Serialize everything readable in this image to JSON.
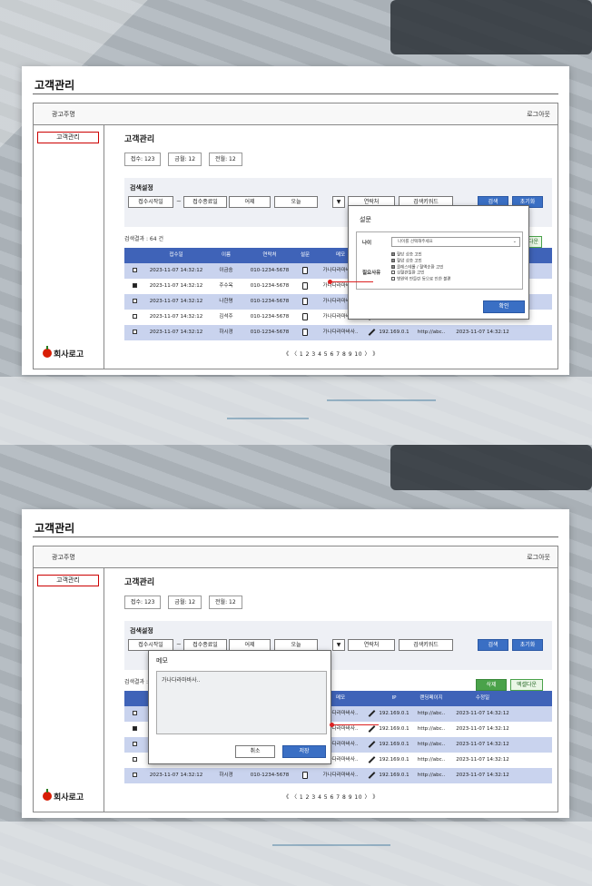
{
  "app_title": "고객관리",
  "brand": "광고주명",
  "logout": "로그아웃",
  "sidebar": {
    "item": "고객관리",
    "company": "회사로고"
  },
  "page_title": "고객관리",
  "stats": [
    "접수: 123",
    "금월: 12",
    "전월: 12"
  ],
  "search": {
    "label": "검색설정",
    "start_date": "접수시작일",
    "tilde": "~",
    "end_date": "접수종료일",
    "yesterday": "어제",
    "today": "오늘",
    "dropdown_arrow": "▼",
    "contact": "연락처",
    "keyword": "검색키워드",
    "search_btn": "검색",
    "reset_btn": "초기화"
  },
  "result_count": "검색결과 : 64 건",
  "actions": {
    "delete": "삭제",
    "excel": "엑셀다운"
  },
  "columns": [
    "",
    "접수일",
    "이름",
    "연락처",
    "설문",
    "메모",
    "",
    "IP",
    "랜딩페이지",
    "수정일"
  ],
  "rows": [
    {
      "checked": false,
      "date": "2023-11-07  14:32:12",
      "name": "이금숭",
      "phone": "010-1234-5678",
      "memo": "가나다라마바사..",
      "ip": "192.169.0.1",
      "landing": "http://abc..",
      "modified": "2023-11-07  14:32:12"
    },
    {
      "checked": true,
      "date": "2023-11-07  14:32:12",
      "name": "주수옥",
      "phone": "010-1234-5678",
      "memo": "가나다라마바사..",
      "ip": "192.169.0.1",
      "landing": "http://abc..",
      "modified": "2023-11-07  14:32:12"
    },
    {
      "checked": false,
      "date": "2023-11-07  14:32:12",
      "name": "나한명",
      "phone": "010-1234-5678",
      "memo": "가나다라마바사..",
      "ip": "192.169.0.1",
      "landing": "http://abc..",
      "modified": "2023-11-07  14:32:12"
    },
    {
      "checked": false,
      "date": "2023-11-07  14:32:12",
      "name": "김석주",
      "phone": "010-1234-5678",
      "memo": "가나다라마바사..",
      "ip": "192.169.0.1",
      "landing": "http://abc..",
      "modified": "2023-11-07  14:32:12"
    },
    {
      "checked": false,
      "date": "2023-11-07  14:32:12",
      "name": "하시경",
      "phone": "010-1234-5678",
      "memo": "가나다라마바사..",
      "ip": "192.169.0.1",
      "landing": "http://abc..",
      "modified": "2023-11-07  14:32:12"
    }
  ],
  "pager": "《 〈 1 2 3 4 5 6 7 8 9 10 〉 》",
  "survey_modal": {
    "title": "설문",
    "age_label": "나이",
    "age_value": "나이를 선택해주세요",
    "concern_label": "필요사유",
    "options": [
      {
        "label": "혈당 상승 고민",
        "checked": true
      },
      {
        "label": "혈압 상승 고민",
        "checked": true
      },
      {
        "label": "콜레스테롤 / 혈액순환 고민",
        "checked": true
      },
      {
        "label": "심혈관질환 고민",
        "checked": false
      },
      {
        "label": "병원약 만들린 등으로 인한 불편",
        "checked": false
      }
    ],
    "confirm": "확인"
  },
  "memo_modal": {
    "title": "메모",
    "text": "가나다라마바사..",
    "cancel": "취소",
    "save": "저장"
  },
  "colors": {
    "header_blue": "#3f63b8",
    "row_alt": "#c9d3ee",
    "button_blue": "#3a6fc4",
    "button_green": "#4aa24a",
    "accent_red": "#d22222"
  }
}
